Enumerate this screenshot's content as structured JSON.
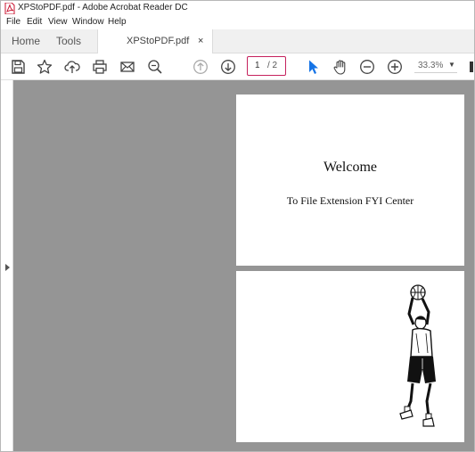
{
  "window": {
    "title": "XPStoPDF.pdf - Adobe Acrobat Reader DC"
  },
  "menu": {
    "file": "File",
    "edit": "Edit",
    "view": "View",
    "window": "Window",
    "help": "Help"
  },
  "tabs": {
    "home": "Home",
    "tools": "Tools",
    "document": "XPStoPDF.pdf",
    "close": "×"
  },
  "toolbar": {
    "icons": [
      "save-icon",
      "star-icon",
      "upload-icon",
      "print-icon",
      "mail-icon",
      "zoom-search-icon",
      "page-up-icon",
      "page-down-icon",
      "select-arrow-icon",
      "hand-icon",
      "zoom-out-icon",
      "zoom-in-icon"
    ],
    "page_current": "1",
    "page_total": "/ 2",
    "zoom": "33.3%"
  },
  "document": {
    "page1_title": "Welcome",
    "page1_subtitle": "To File Extension FYI Center"
  },
  "colors": {
    "viewer_bg": "#959595",
    "page_box_border": "#c5225d",
    "select_tool": "#1473e6",
    "tab_bar": "#f0f0f0"
  }
}
